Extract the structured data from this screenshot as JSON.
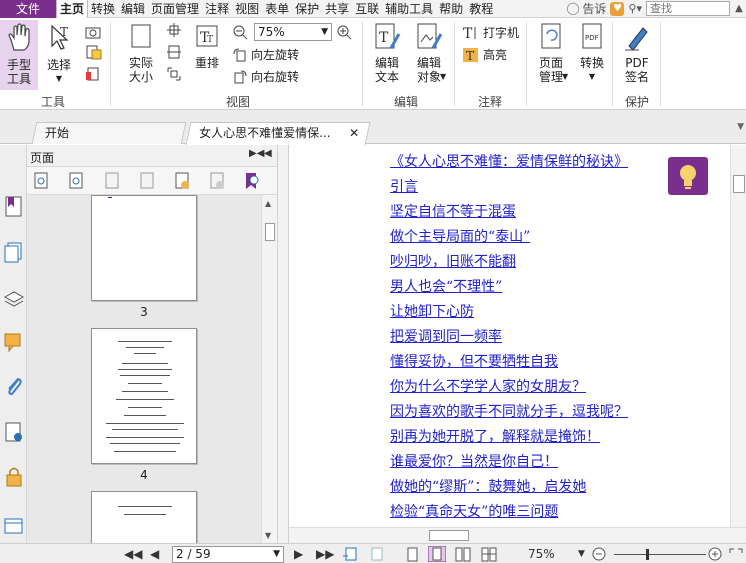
{
  "menu": {
    "file": "文件",
    "items": [
      "主页",
      "转换",
      "编辑",
      "页面管理",
      "注释",
      "视图",
      "表单",
      "保护",
      "共享",
      "互联",
      "辅助工具",
      "帮助",
      "教程"
    ],
    "tell": "告诉",
    "search_placeholder": "查找"
  },
  "ribbon": {
    "hand": "手型\n工具",
    "select": "选择",
    "actual_size": "实际\n大小",
    "reflow": "重排",
    "zoom_value": "75%",
    "rotate_left": "向左旋转",
    "rotate_right": "向右旋转",
    "edit_text": "编辑\n文本",
    "edit_object": "编辑\n对象",
    "typewriter": "打字机",
    "highlight": "高亮",
    "page_manage": "页面\n管理",
    "convert": "转换",
    "pdf_sign": "PDF\n签名",
    "groups": {
      "tools": "工具",
      "view": "视图",
      "edit": "编辑",
      "comment": "注释",
      "protect": "保护"
    }
  },
  "tabs": [
    {
      "label": "开始"
    },
    {
      "label": "女人心思不难懂爱情保..."
    }
  ],
  "panel": {
    "title": "页面",
    "thumbs": [
      "3",
      "4"
    ]
  },
  "toc": [
    "《女人心思不难懂：爱情保鲜的秘诀》",
    "引言",
    "坚定自信不等于混蛋",
    "做个主导局面的“泰山”",
    "吵归吵，旧账不能翻",
    "男人也会“不理性”",
    "让她卸下心防",
    "把爱调到同一频率",
    "懂得妥协，但不要牺牲自我",
    "你为什么不学学人家的女朋友？",
    "因为喜欢的歌手不同就分手，逗我呢？",
    "别再为她开脱了，解释就是掩饰！",
    "谁最爱你？当然是你自己！",
    "做她的“缪斯”：鼓舞她，启发她",
    "检验“真命天女”的唯三问题"
  ],
  "status": {
    "page": "2 / 59",
    "zoom": "75%"
  },
  "colors": {
    "brand": "#7b2f8c",
    "link": "#2222cc"
  }
}
